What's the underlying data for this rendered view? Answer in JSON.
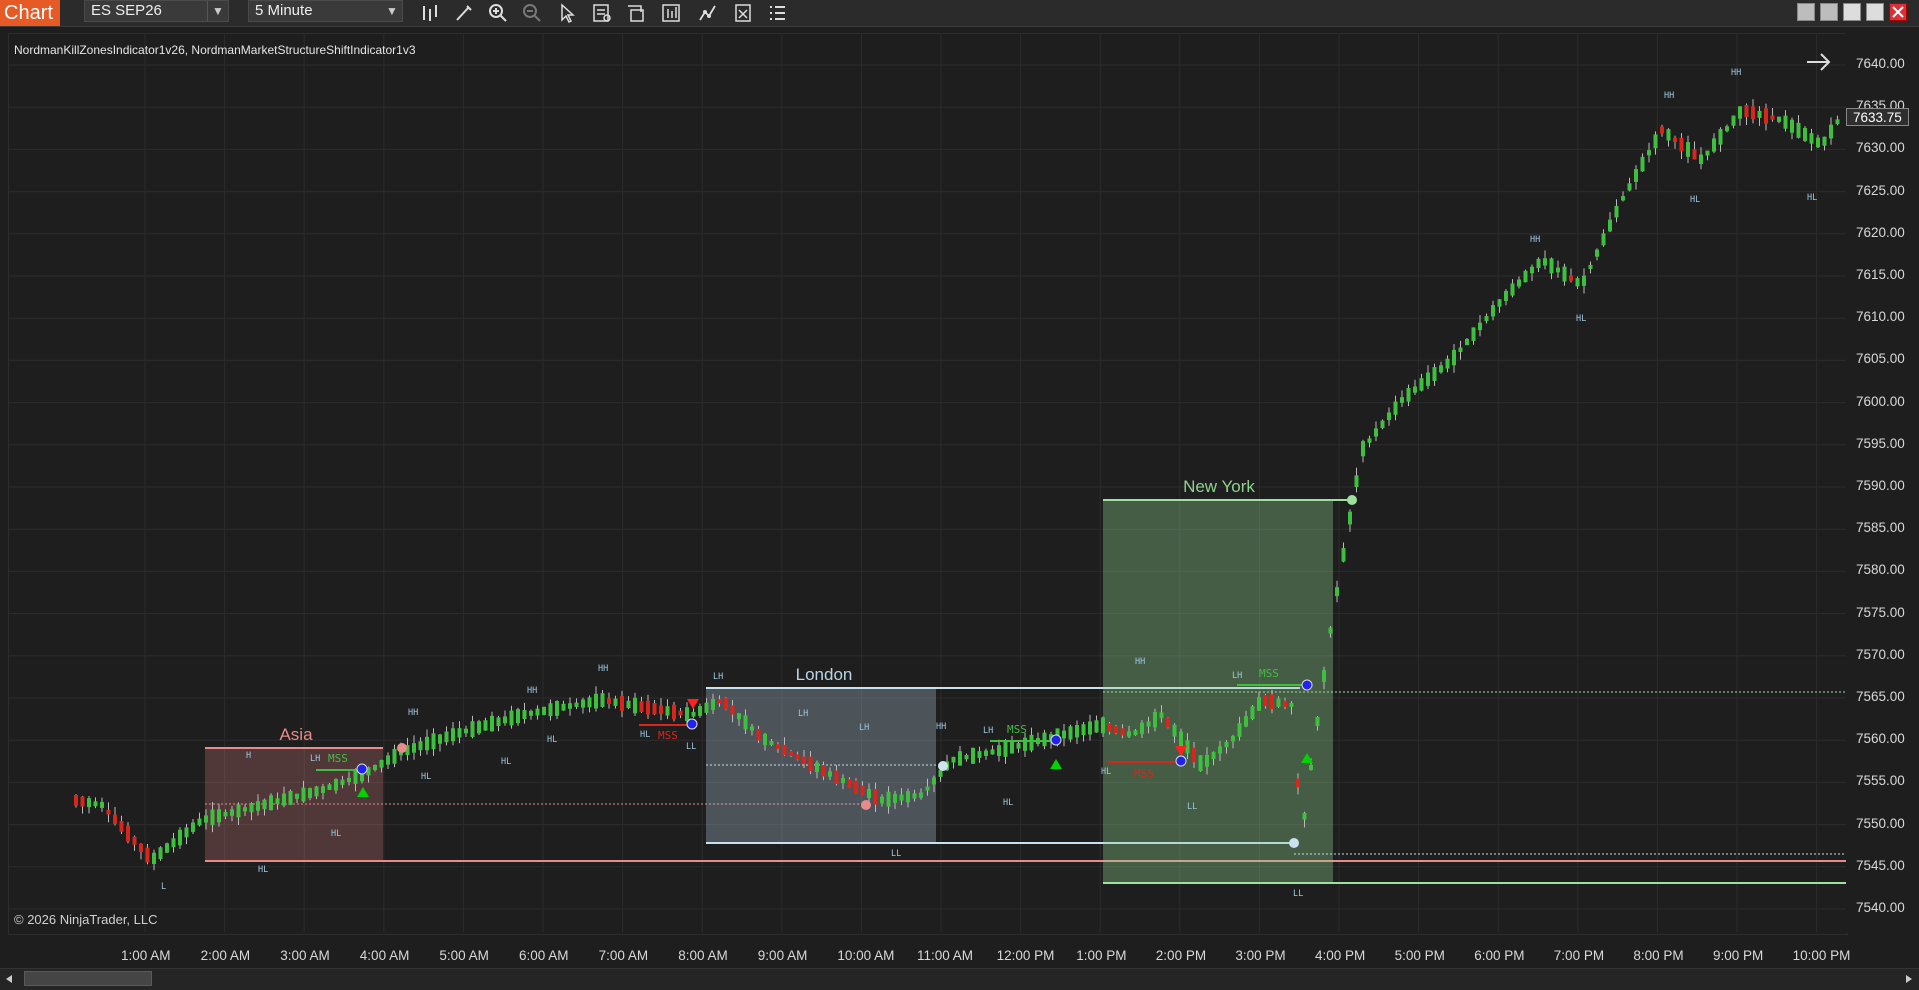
{
  "window": {
    "title": "Chart"
  },
  "toolbar": {
    "instrument": "ES SEP26",
    "interval": "5 Minute",
    "icons": [
      "bar-style-icon",
      "draw-pencil-icon",
      "zoom-in-icon",
      "zoom-out-icon",
      "pointer-icon",
      "data-box-icon",
      "properties-icon",
      "chart-trader-icon",
      "strategies-icon",
      "list-icon"
    ],
    "window_buttons": [
      "restore",
      "maximize",
      "minimize",
      "pop-out",
      "close"
    ]
  },
  "chart": {
    "indicators_label": "NordmanKillZonesIndicator1v26, NordmanMarketStructureShiftIndicator1v3",
    "copyright": "© 2026 NinjaTrader, LLC",
    "current_price": "7633.75",
    "price_labels": [
      "7640.00",
      "7635.00",
      "7630.00",
      "7625.00",
      "7620.00",
      "7615.00",
      "7610.00",
      "7605.00",
      "7600.00",
      "7595.00",
      "7590.00",
      "7585.00",
      "7580.00",
      "7575.00",
      "7570.00",
      "7565.00",
      "7560.00",
      "7555.00",
      "7550.00",
      "7545.00",
      "7540.00"
    ],
    "time_labels": [
      "1:00 AM",
      "2:00 AM",
      "3:00 AM",
      "4:00 AM",
      "5:00 AM",
      "6:00 AM",
      "7:00 AM",
      "8:00 AM",
      "9:00 AM",
      "10:00 AM",
      "11:00 AM",
      "12:00 PM",
      "1:00 PM",
      "2:00 PM",
      "3:00 PM",
      "4:00 PM",
      "5:00 PM",
      "6:00 PM",
      "7:00 PM",
      "8:00 PM",
      "9:00 PM",
      "10:00 PM"
    ],
    "sessions": [
      {
        "name": "Asia",
        "color": "#e88b8b"
      },
      {
        "name": "London",
        "color": "#b8d4e6"
      },
      {
        "name": "New York",
        "color": "#8fd18f"
      }
    ],
    "colors": {
      "up": "#3fbf3f",
      "down": "#d9261c",
      "background": "#1e1e1e"
    }
  }
}
